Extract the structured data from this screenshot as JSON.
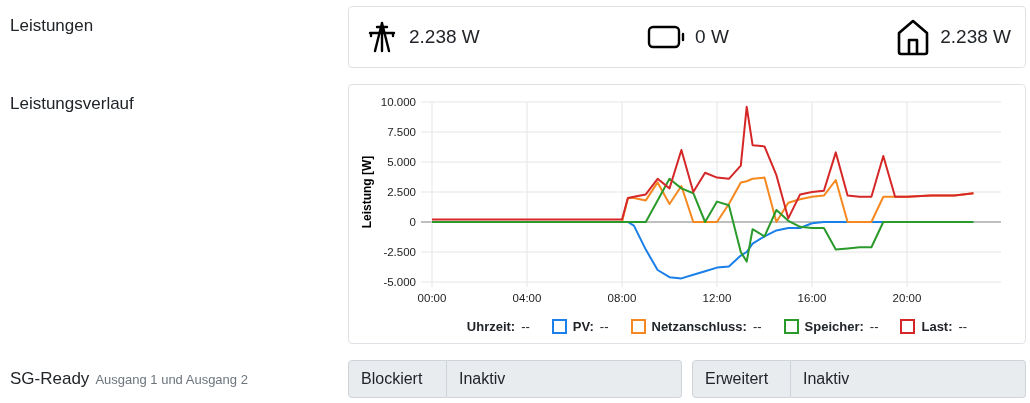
{
  "sections": [
    {
      "kind": "power",
      "label": "Leistungen",
      "items": [
        {
          "kind": "grid",
          "value": "2.238 W"
        },
        {
          "kind": "battery",
          "value": "0 W"
        },
        {
          "kind": "house",
          "value": "2.238 W"
        }
      ]
    },
    {
      "kind": "chart",
      "label": "Leistungsverlauf",
      "chart_data": {
        "type": "line",
        "grid": true,
        "ylabel": "Leistung [W]",
        "ylim": [
          -5000,
          10000
        ],
        "xlim": [
          0,
          24
        ],
        "yticks": [
          {
            "value": 10000,
            "label": "10.000"
          },
          {
            "value": 7500,
            "label": "7.500"
          },
          {
            "value": 5000,
            "label": "5.000"
          },
          {
            "value": 2500,
            "label": "2.500"
          },
          {
            "value": 0,
            "label": "0"
          },
          {
            "value": -2500,
            "label": "-2.500"
          },
          {
            "value": -5000,
            "label": "-5.000"
          }
        ],
        "xticks": [
          {
            "value": 0,
            "label": "00:00"
          },
          {
            "value": 4,
            "label": "04:00"
          },
          {
            "value": 8,
            "label": "08:00"
          },
          {
            "value": 12,
            "label": "12:00"
          },
          {
            "value": 16,
            "label": "16:00"
          },
          {
            "value": 20,
            "label": "20:00"
          }
        ],
        "x": [
          0,
          1,
          2,
          3,
          4,
          5,
          6,
          7,
          8,
          8.25,
          8.5,
          9,
          9.5,
          10,
          10.5,
          11,
          11.5,
          12,
          12.5,
          13,
          13.25,
          13.5,
          14,
          14.5,
          15,
          15.5,
          16,
          16.5,
          17,
          17.5,
          18,
          18.5,
          19,
          19.5,
          20,
          21,
          22,
          22.8
        ],
        "series": [
          {
            "name": "PV:",
            "color": "#1a7fe8",
            "values": [
              null,
              null,
              null,
              null,
              null,
              null,
              null,
              null,
              0,
              0,
              -300,
              -2300,
              -4000,
              -4600,
              -4700,
              -4400,
              -4100,
              -3800,
              -3700,
              -2800,
              -2500,
              -1800,
              -1200,
              -700,
              -500,
              -500,
              -100,
              0,
              0,
              0,
              0,
              0,
              0,
              0,
              null,
              null,
              null,
              null
            ]
          },
          {
            "name": "Netzanschluss:",
            "color": "#f5891f",
            "values": [
              null,
              null,
              null,
              null,
              null,
              null,
              null,
              0,
              0,
              2000,
              2000,
              1800,
              3300,
              1500,
              3000,
              0,
              0,
              0,
              1500,
              3300,
              3400,
              3600,
              3700,
              0,
              1600,
              1900,
              2100,
              2200,
              3500,
              0,
              0,
              0,
              2100,
              2100,
              2100,
              2200,
              2200,
              2400
            ]
          },
          {
            "name": "Speicher:",
            "color": "#2a9a2a",
            "values": [
              0,
              0,
              0,
              0,
              0,
              0,
              0,
              0,
              0,
              0,
              0,
              0,
              1800,
              3600,
              2800,
              2400,
              0,
              1700,
              1400,
              -2500,
              -3300,
              -600,
              -1200,
              1000,
              100,
              -400,
              -500,
              -500,
              -2300,
              -2200,
              -2100,
              -2100,
              0,
              0,
              0,
              0,
              0,
              0
            ]
          },
          {
            "name": "Last:",
            "color": "#d62728",
            "values": [
              200,
              200,
              200,
              200,
              200,
              200,
              200,
              200,
              200,
              2000,
              2100,
              2300,
              3600,
              2800,
              6000,
              2500,
              4100,
              3700,
              3600,
              4700,
              9600,
              6400,
              6300,
              3900,
              300,
              2300,
              2500,
              2600,
              5800,
              2200,
              2100,
              2100,
              5500,
              2100,
              2100,
              2200,
              2200,
              2400
            ]
          }
        ]
      },
      "time_legend": {
        "label": "Uhrzeit:",
        "value": "--"
      },
      "legend_values": [
        "--",
        "--",
        "--",
        "--"
      ]
    },
    {
      "kind": "sgready",
      "label": "SG-Ready",
      "sublabel": "Ausgang 1 und Ausgang 2",
      "groups": [
        {
          "name": "Blockiert",
          "value": "Inaktiv"
        },
        {
          "name": "Erweitert",
          "value": "Inaktiv"
        }
      ]
    }
  ]
}
